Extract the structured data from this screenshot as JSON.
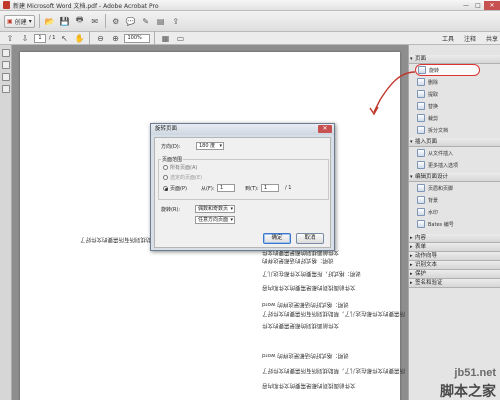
{
  "window": {
    "title": "新建 Microsoft Word 文档.pdf - Adobe Acrobat Pro",
    "min": "—",
    "max": "□",
    "close": "✕"
  },
  "toolbar": {
    "create_label": "创建",
    "create_caret": "▾"
  },
  "nav": {
    "page_current": "1",
    "page_total": "/ 1",
    "zoom": "100%",
    "tabs": [
      "工具",
      "注释",
      "共享"
    ]
  },
  "document": {
    "lines": [
      "说明：格式好，所需要的文件都在这儿了，帮助找到所有所需要的文件好了",
      "文件前面找到的都是需要的文件",
      "说明：格式好的话都是这样的",
      "说明：格式好，所需要的文件都在这儿了",
      "文件前面找到的都是需要的文件和内容",
      "说明：格式好的话都是这样的 word",
      "说明：格式好，所需要的文件都在这儿了，帮助找到所有所需要的文件好了",
      "文件前面找到的都是需要的文件",
      "说明：格式好的话都是这样的 word",
      "说明：格式好，所需要的文件都在这儿了，帮助找到所有所需要的文件好了",
      "文件前面找到的都是需要的文件和内容"
    ]
  },
  "dialog": {
    "title": "旋转页面",
    "close": "✕",
    "direction_label": "方向(D):",
    "direction_value": "180 度",
    "range_label": "页面范围",
    "all_pages": "所有页面(A)",
    "selected_pages": "选定的页面(E)",
    "pages_label": "页面(P)",
    "from_label": "从(F):",
    "from_value": "1",
    "to_label": "到(T):",
    "to_value": "1",
    "of_total": "/ 1",
    "rotate_label": "旋转(R):",
    "rotate_value": "偶数和奇数页",
    "orientation_value": "任意方向页面",
    "ok": "确定",
    "cancel": "取消"
  },
  "panel": {
    "pages_header": "页面",
    "page_items": [
      {
        "label": "旋转",
        "active": true
      },
      {
        "label": "删除",
        "active": false
      },
      {
        "label": "提取",
        "active": false
      },
      {
        "label": "替换",
        "active": false
      },
      {
        "label": "裁剪",
        "active": false
      },
      {
        "label": "拆分文档",
        "active": false
      }
    ],
    "insert_header": "插入页面",
    "insert_items": [
      {
        "label": "从文件插入"
      },
      {
        "label": "更多插入选项"
      }
    ],
    "design_header": "编辑页面设计",
    "design_items": [
      {
        "label": "页眉和页脚"
      },
      {
        "label": "背景"
      },
      {
        "label": "水印"
      },
      {
        "label": "Bates 编号"
      }
    ],
    "closed_sections": [
      "内容",
      "表单",
      "动作向导",
      "识别文本",
      "保护",
      "签名和验证"
    ]
  },
  "watermark": {
    "top": "jb51.net",
    "bottom": "脚本之家"
  }
}
